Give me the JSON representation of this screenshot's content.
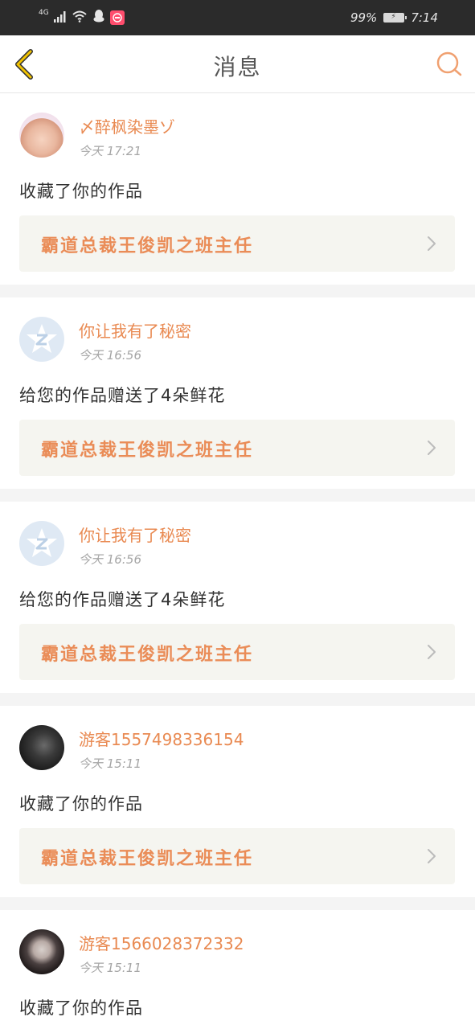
{
  "status_bar": {
    "network": "4G",
    "battery": "99%",
    "time": "7:14",
    "icons": [
      "signal-icon",
      "wifi-icon",
      "qq-icon",
      "app-icon"
    ]
  },
  "nav": {
    "title": "消息",
    "back_icon": "chevron-left-icon",
    "search_icon": "search-icon"
  },
  "colors": {
    "accent": "#e98a52",
    "nav_back": "#f2c300"
  },
  "messages": [
    {
      "username": "〆醉枫染墨ゾ",
      "time": "今天 17:21",
      "action": "收藏了你的作品",
      "work": "霸道总裁王俊凯之班主任",
      "avatar": "photo"
    },
    {
      "username": "你让我有了秘密",
      "time": "今天 16:56",
      "action": "给您的作品赠送了4朵鲜花",
      "work": "霸道总裁王俊凯之班主任",
      "avatar": "default"
    },
    {
      "username": "你让我有了秘密",
      "time": "今天 16:56",
      "action": "给您的作品赠送了4朵鲜花",
      "work": "霸道总裁王俊凯之班主任",
      "avatar": "default"
    },
    {
      "username": "游客1557498336154",
      "time": "今天 15:11",
      "action": "收藏了你的作品",
      "work": "霸道总裁王俊凯之班主任",
      "avatar": "photo"
    },
    {
      "username": "游客1566028372332",
      "time": "今天 15:11",
      "action": "收藏了你的作品",
      "work": "",
      "avatar": "photo"
    }
  ]
}
